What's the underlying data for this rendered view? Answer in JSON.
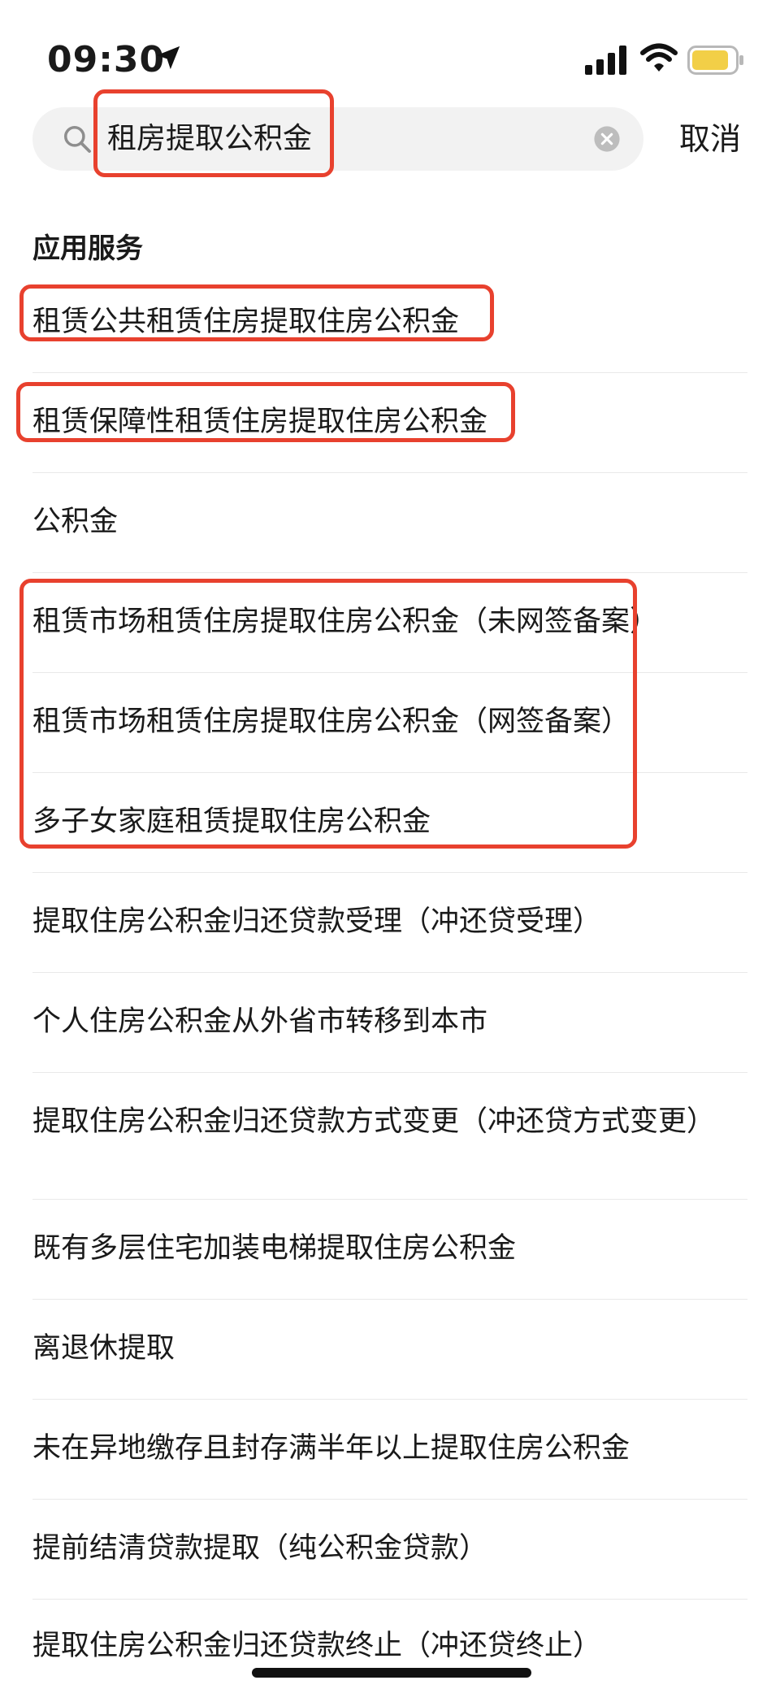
{
  "status_bar": {
    "time": "09:30",
    "icons": [
      "location-arrow-icon",
      "signal-icon",
      "wifi-icon",
      "battery-icon"
    ],
    "battery_color": "#f2cf47"
  },
  "search": {
    "query": "租房提取公积金",
    "cancel_label": "取消"
  },
  "section": {
    "title": "应用服务"
  },
  "results": [
    "租赁公共租赁住房提取住房公积金",
    "租赁保障性租赁住房提取住房公积金",
    "公积金",
    "租赁市场租赁住房提取住房公积金（未网签备案）",
    "租赁市场租赁住房提取住房公积金（网签备案）",
    "多子女家庭租赁提取住房公积金",
    "提取住房公积金归还贷款受理（冲还贷受理）",
    "个人住房公积金从外省市转移到本市",
    "提取住房公积金归还贷款方式变更（冲还贷方式变更）",
    "既有多层住宅加装电梯提取住房公积金",
    "离退休提取",
    "未在异地缴存且封存满半年以上提取住房公积金",
    "提前结清贷款提取（纯公积金贷款）",
    "提取住房公积金归还贷款终止（冲还贷终止）"
  ],
  "highlight_color": "#e8412e"
}
